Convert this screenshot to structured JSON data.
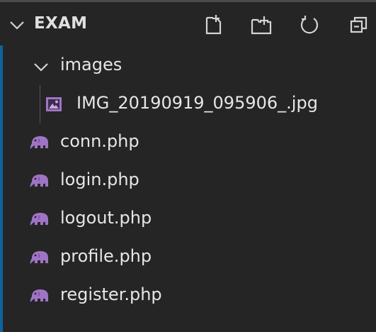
{
  "explorer": {
    "section_title": "EXAM",
    "actions": [
      {
        "name": "new-file",
        "icon": "new-file-icon"
      },
      {
        "name": "new-folder",
        "icon": "new-folder-icon"
      },
      {
        "name": "refresh",
        "icon": "refresh-icon"
      },
      {
        "name": "collapse-all",
        "icon": "collapse-all-icon"
      }
    ],
    "tree": {
      "folder": {
        "label": "images",
        "expanded": true,
        "icon": "chevron-down-icon"
      },
      "image_file": {
        "label": "IMG_20190919_095906_.jpg",
        "icon": "image-file-icon"
      },
      "php_files": [
        {
          "label": "conn.php",
          "icon": "php-elephant-icon"
        },
        {
          "label": "login.php",
          "icon": "php-elephant-icon"
        },
        {
          "label": "logout.php",
          "icon": "php-elephant-icon"
        },
        {
          "label": "profile.php",
          "icon": "php-elephant-icon"
        },
        {
          "label": "register.php",
          "icon": "php-elephant-icon"
        }
      ]
    }
  },
  "colors": {
    "background": "#252526",
    "text": "#e6e6e6",
    "php_icon": "#a074c4",
    "focus_border": "#0e639c",
    "image_icon": "#a074c4"
  }
}
